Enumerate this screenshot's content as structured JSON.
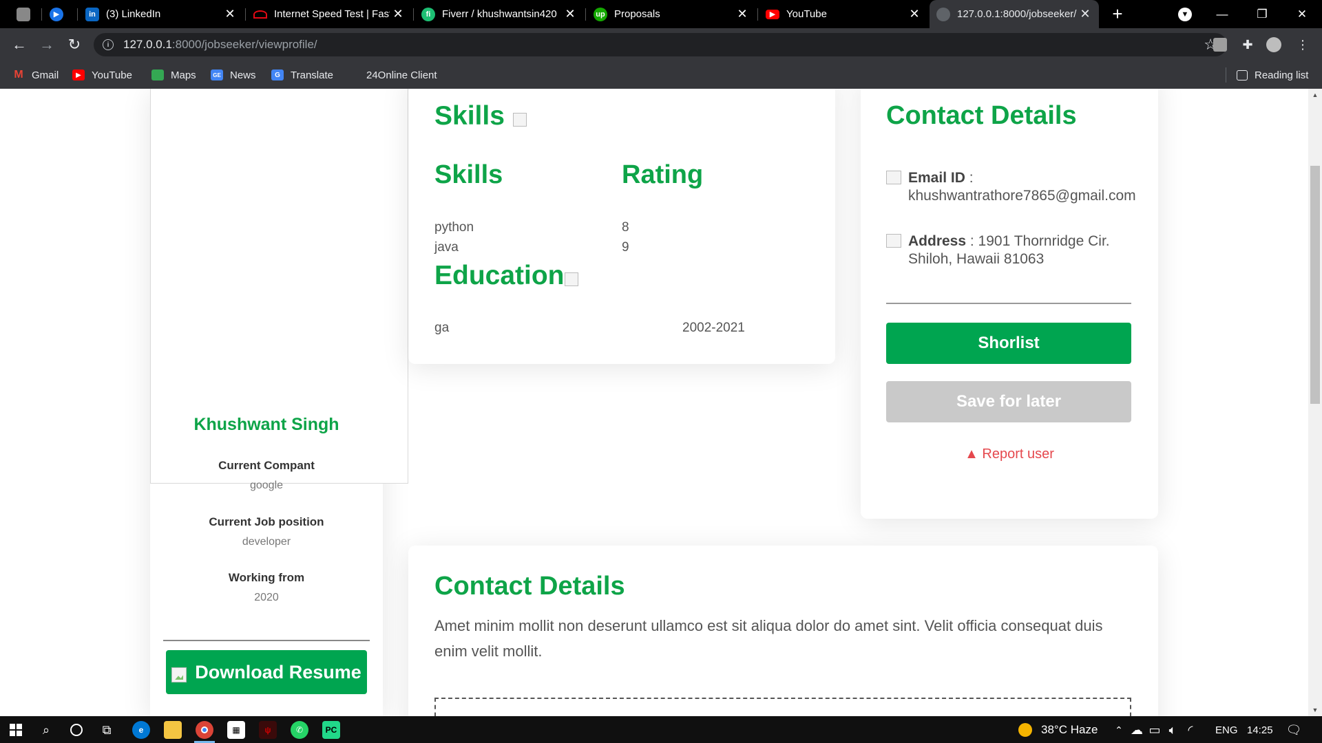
{
  "browser": {
    "tabs": [
      {
        "title": "",
        "favicon": "pen",
        "active": false
      },
      {
        "title": "",
        "favicon": "play",
        "active": false
      },
      {
        "title": "(3) LinkedIn",
        "favicon": "in",
        "active": false
      },
      {
        "title": "Internet Speed Test | Fast.com",
        "favicon": "speed",
        "active": false
      },
      {
        "title": "Fiverr / khushwantsin420",
        "favicon": "fi",
        "active": false
      },
      {
        "title": "Proposals",
        "favicon": "up",
        "active": false
      },
      {
        "title": "YouTube",
        "favicon": "yt",
        "active": false
      },
      {
        "title": "127.0.0.1:8000/jobseeker/",
        "favicon": "globe",
        "active": true
      }
    ],
    "url_host": "127.0.0.1",
    "url_path": ":8000/jobseeker/viewprofile/",
    "bookmarks": [
      "Gmail",
      "YouTube",
      "Maps",
      "News",
      "Translate",
      "24Online Client"
    ],
    "reading_list": "Reading list"
  },
  "profile": {
    "name": "Khushwant Singh",
    "current_company_label": "Current Compant",
    "current_company": "google",
    "job_position_label": "Current Job position",
    "job_position": "developer",
    "working_from_label": "Working from",
    "working_from": "2020",
    "download_label": "Download Resume"
  },
  "skills": {
    "section_title": "Skills",
    "col_skill": "Skills",
    "col_rating": "Rating",
    "rows": [
      {
        "skill": "python",
        "rating": "8"
      },
      {
        "skill": "java",
        "rating": "9"
      }
    ]
  },
  "education": {
    "section_title": "Education",
    "rows": [
      {
        "name": "ga",
        "years": "2002-2021"
      }
    ]
  },
  "contact": {
    "title": "Contact Details",
    "email_label": "Email ID",
    "email": "khushwantrathore7865@gmail.com",
    "address_label": "Address",
    "address": "1901 Thornridge Cir. Shiloh, Hawaii 81063",
    "shortlist": "Shorlist",
    "save_later": "Save for later",
    "report": "Report user"
  },
  "bottom": {
    "title": "Contact Details",
    "text": "Amet minim mollit non deserunt ullamco est sit aliqua dolor do amet sint. Velit officia consequat duis enim velit mollit."
  },
  "taskbar": {
    "weather": "38°C  Haze",
    "lang": "ENG",
    "time": "14:25"
  },
  "colors": {
    "accent_green": "#0ea448",
    "button_green": "#00a550",
    "report_red": "#e5484d"
  }
}
